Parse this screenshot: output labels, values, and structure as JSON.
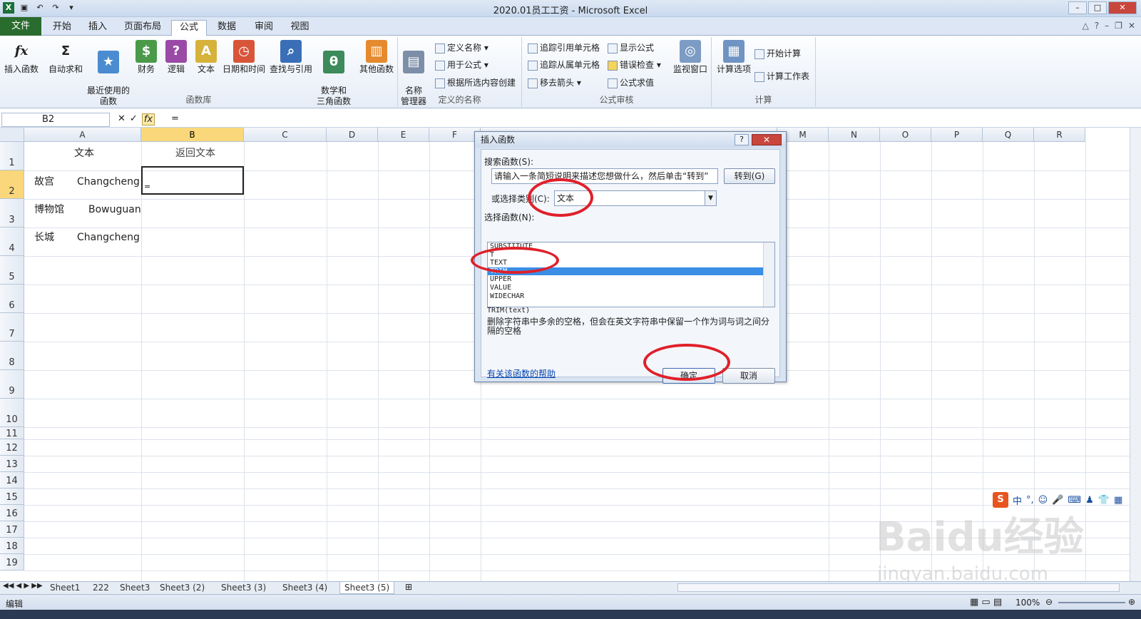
{
  "window": {
    "title": "2020.01员工工资 - Microsoft Excel"
  },
  "tabs": {
    "file": "文件",
    "items": [
      "开始",
      "插入",
      "页面布局",
      "公式",
      "数据",
      "审阅",
      "视图"
    ],
    "active": "公式"
  },
  "ribbon": {
    "function_library": {
      "label": "函数库",
      "insert_function": "插入函数",
      "autosum": "自动求和",
      "recent": "最近使用的\n函数",
      "financial": "财务",
      "logical": "逻辑",
      "text": "文本",
      "datetime": "日期和时间",
      "lookup": "查找与引用",
      "math": "数学和\n三角函数",
      "other": "其他函数"
    },
    "defined_names": {
      "label": "定义的名称",
      "name_manager": "名称\n管理器",
      "define_name": "定义名称",
      "use_in_formula": "用于公式",
      "create_from_selection": "根据所选内容创建"
    },
    "formula_auditing": {
      "label": "公式审核",
      "trace_precedents": "追踪引用单元格",
      "trace_dependents": "追踪从属单元格",
      "remove_arrows": "移去箭头",
      "show_formulas": "显示公式",
      "error_checking": "错误检查",
      "evaluate_formula": "公式求值",
      "watch_window": "监视窗口"
    },
    "calculation": {
      "label": "计算",
      "options": "计算选项",
      "calc_now": "开始计算",
      "calc_sheet": "计算工作表"
    }
  },
  "formula_bar": {
    "name_box": "B2",
    "content": "="
  },
  "columns": [
    "A",
    "B",
    "C",
    "D",
    "E",
    "F",
    "M",
    "N",
    "O",
    "P",
    "Q",
    "R"
  ],
  "rows": [
    "1",
    "2",
    "3",
    "4",
    "5",
    "6",
    "7",
    "8",
    "9",
    "10",
    "11",
    "12",
    "13",
    "14",
    "15",
    "16",
    "17",
    "18",
    "19"
  ],
  "cells": {
    "a1": "文本",
    "b1": "返回文本",
    "a2_cn": "故宫",
    "a2_en": "Changcheng",
    "a3_cn": "博物馆",
    "a3_en": "Bowuguan",
    "a4_cn": "长城",
    "a4_en": "Changcheng",
    "b2": "="
  },
  "dialog": {
    "title": "插入函数",
    "search_label": "搜索函数(S):",
    "search_value": "请输入一条简短说明来描述您想做什么，然后单击“转到”",
    "goto": "转到(G)",
    "category_label": "或选择类别(C):",
    "category_value": "文本",
    "select_label": "选择函数(N):",
    "functions": [
      "SUBSTITUTE",
      "T",
      "TEXT",
      "TRIM",
      "UPPER",
      "VALUE",
      "WIDECHAR"
    ],
    "selected_function": "TRIM",
    "signature": "TRIM(text)",
    "description": "删除字符串中多余的空格，但会在英文字符串中保留一个作为词与词之间分隔的空格",
    "help_link": "有关该函数的帮助",
    "ok": "确定",
    "cancel": "取消"
  },
  "sheets": [
    "Sheet1",
    "222",
    "Sheet3",
    "Sheet3 (2)",
    "Sheet3 (3)",
    "Sheet3 (4)",
    "Sheet3 (5)"
  ],
  "active_sheet": "Sheet3 (5)",
  "status": {
    "mode": "编辑",
    "zoom": "100%"
  },
  "ime": {
    "lang": "中"
  },
  "watermark": {
    "logo": "Baidu经验",
    "url": "jingyan.baidu.com"
  },
  "colors": {
    "file_tab": "#2a6b2e",
    "selected_header": "#f9d77a",
    "selection": "#3a8ee6",
    "annotation": "#e0202a"
  }
}
